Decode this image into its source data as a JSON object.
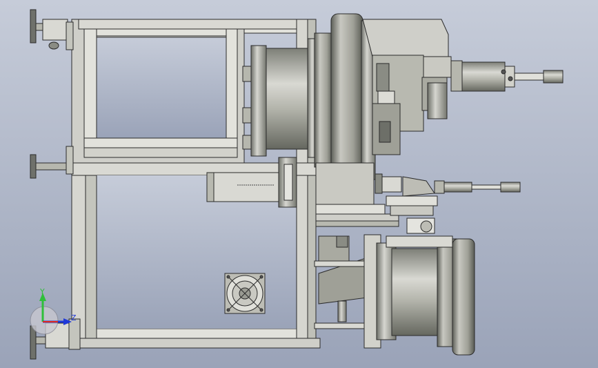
{
  "viewport": {
    "background_top": "#c6ccd9",
    "background_bottom": "#9aa3b8"
  },
  "triad": {
    "y_label": "Y",
    "z_label": "Z",
    "y_color": "#2fbf3a",
    "x_color": "#e0281e",
    "z_color": "#1f38d8"
  },
  "colors": {
    "frame_fill": "#cfcfc9",
    "metal_dark": "#8a8c84",
    "metal_mid": "#b6b7ae",
    "metal_light": "#e4e4df",
    "stroke": "#2a2a2a",
    "foot": "#6f716b"
  }
}
